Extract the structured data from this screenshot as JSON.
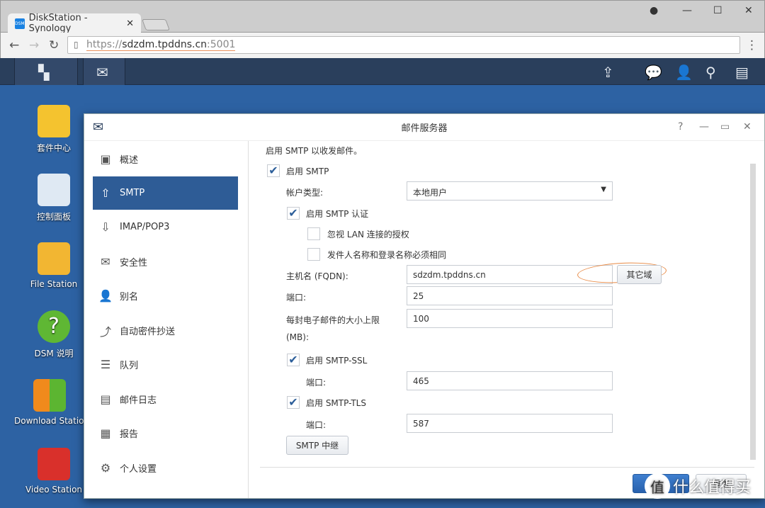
{
  "browser": {
    "tab_title": "DiskStation - Synology",
    "favicon": "DSM",
    "url_scheme": "https://",
    "url_host": "sdzdm.tpddns.cn",
    "url_port": ":5001"
  },
  "desktop": {
    "icons": [
      {
        "label": "套件中心"
      },
      {
        "label": "控制面板"
      },
      {
        "label": "File Station"
      },
      {
        "label": "DSM 说明"
      },
      {
        "label": "Download Station"
      },
      {
        "label": "Video Station"
      }
    ]
  },
  "window": {
    "title": "邮件服务器",
    "sidebar": [
      {
        "label": "概述",
        "icon": "overview-icon"
      },
      {
        "label": "SMTP",
        "icon": "upload-tray-icon",
        "active": true
      },
      {
        "label": "IMAP/POP3",
        "icon": "download-tray-icon"
      },
      {
        "label": "安全性",
        "icon": "mail-block-icon"
      },
      {
        "label": "别名",
        "icon": "user-alias-icon"
      },
      {
        "label": "自动密件抄送",
        "icon": "auto-bcc-icon"
      },
      {
        "label": "队列",
        "icon": "list-icon"
      },
      {
        "label": "邮件日志",
        "icon": "log-icon"
      },
      {
        "label": "报告",
        "icon": "report-icon"
      },
      {
        "label": "个人设置",
        "icon": "gear-icon"
      }
    ],
    "smtp": {
      "intro": "启用 SMTP 以收发邮件。",
      "enable_smtp": "启用 SMTP",
      "enable_smtp_checked": true,
      "account_type_label": "帐户类型:",
      "account_type_value": "本地用户",
      "smtp_auth": "启用 SMTP 认证",
      "smtp_auth_checked": true,
      "ignore_lan": "忽视 LAN 连接的授权",
      "ignore_lan_checked": false,
      "sender_match": "发件人名称和登录名称必须相同",
      "sender_match_checked": false,
      "hostname_label": "主机名 (FQDN):",
      "hostname_value": "sdzdm.tpddns.cn",
      "other_domain": "其它域",
      "port_label": "端口:",
      "port_value": "25",
      "max_size_label": "每封电子邮件的大小上限",
      "max_size_unit": "(MB):",
      "max_size_value": "100",
      "ssl": "启用 SMTP-SSL",
      "ssl_checked": true,
      "ssl_port_label": "端口:",
      "ssl_port": "465",
      "tls": "启用 SMTP-TLS",
      "tls_checked": true,
      "tls_port_label": "端口:",
      "tls_port": "587",
      "relay": "SMTP 中继"
    },
    "apply": "应用",
    "reset": "重置"
  },
  "watermark": "值 什么值得买"
}
